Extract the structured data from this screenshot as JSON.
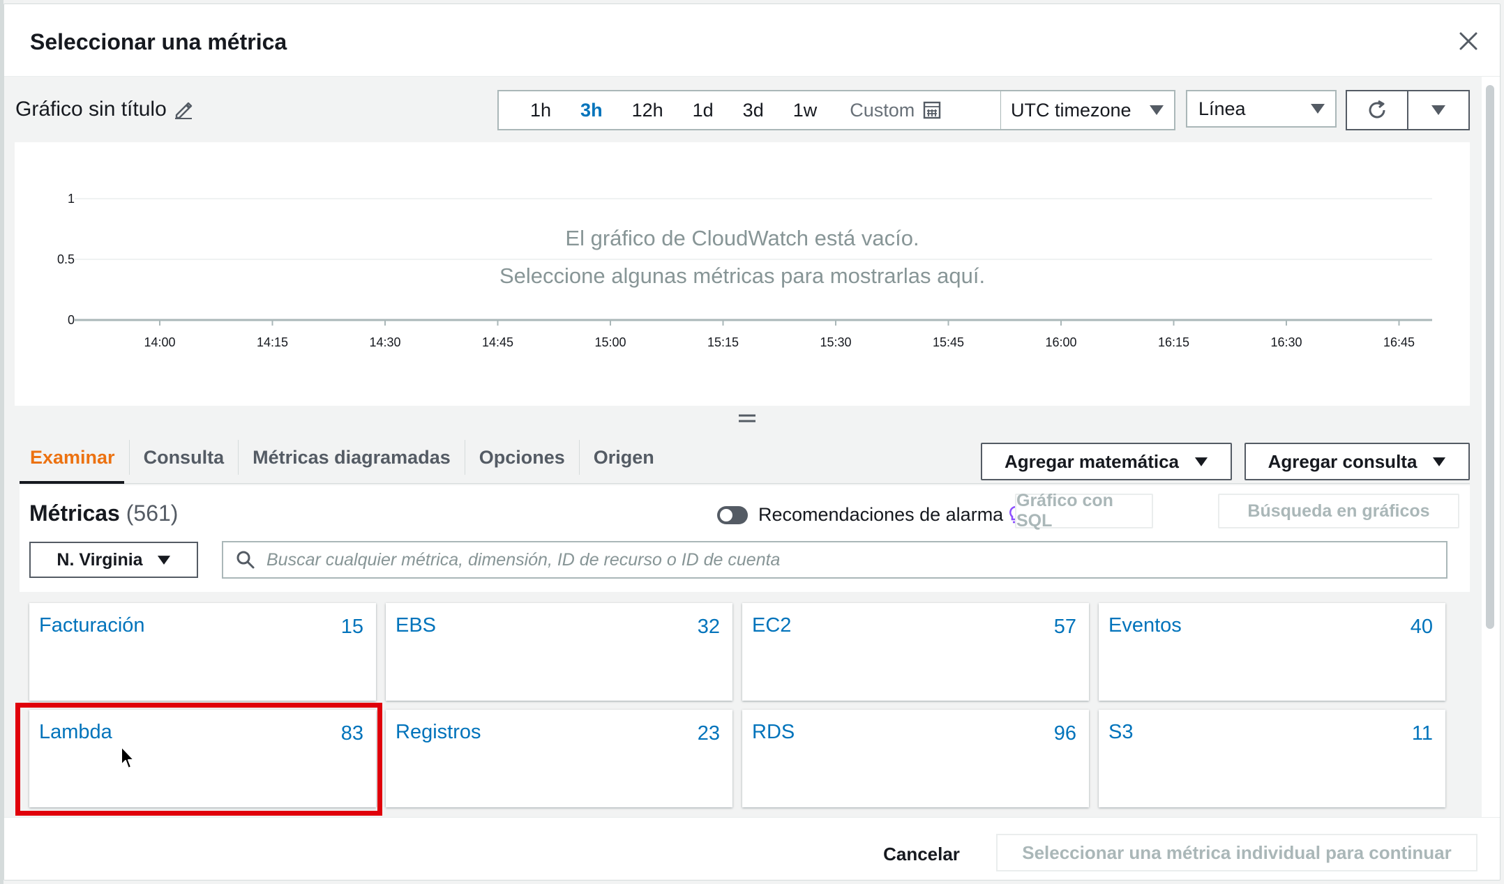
{
  "modal": {
    "title": "Seleccionar una métrica"
  },
  "graph": {
    "title": "Gráfico sin título",
    "time_ranges": [
      "1h",
      "3h",
      "12h",
      "1d",
      "3d",
      "1w"
    ],
    "active_time_range": "3h",
    "custom_label": "Custom",
    "timezone": "UTC timezone",
    "chart_type": "Línea",
    "empty_line1": "El gráfico de CloudWatch está vacío.",
    "empty_line2": "Seleccione algunas métricas para mostrarlas aquí."
  },
  "chart_data": {
    "type": "line",
    "title": "",
    "xlabel": "",
    "ylabel": "",
    "y_ticks": [
      "1",
      "0.5",
      "0"
    ],
    "ylim": [
      0,
      1
    ],
    "x": [
      "14:00",
      "14:15",
      "14:30",
      "14:45",
      "15:00",
      "15:15",
      "15:30",
      "15:45",
      "16:00",
      "16:15",
      "16:30",
      "16:45"
    ],
    "series": [],
    "grid": true
  },
  "tabs": [
    {
      "label": "Examinar",
      "active": true
    },
    {
      "label": "Consulta"
    },
    {
      "label": "Métricas diagramadas"
    },
    {
      "label": "Opciones"
    },
    {
      "label": "Origen"
    }
  ],
  "actions": {
    "add_math": "Agregar matemática",
    "add_query": "Agregar consulta"
  },
  "metrics": {
    "title": "Métricas",
    "count": "(561)",
    "alarm_recommendations": "Recomendaciones de alarma",
    "graph_sql": "Gráfico con SQL",
    "graph_search": "Búsqueda en gráficos",
    "region": "N. Virginia",
    "search_placeholder": "Buscar cualquier métrica, dimensión, ID de recurso o ID de cuenta",
    "namespaces": [
      {
        "name": "Facturación",
        "count": "15"
      },
      {
        "name": "EBS",
        "count": "32"
      },
      {
        "name": "EC2",
        "count": "57"
      },
      {
        "name": "Eventos",
        "count": "40"
      },
      {
        "name": "Lambda",
        "count": "83"
      },
      {
        "name": "Registros",
        "count": "23"
      },
      {
        "name": "RDS",
        "count": "96"
      },
      {
        "name": "S3",
        "count": "11"
      }
    ]
  },
  "footer": {
    "cancel": "Cancelar",
    "continue": "Seleccionar una métrica individual para continuar"
  },
  "colors": {
    "link": "#0073bb",
    "active_tab": "#ec7211",
    "highlight": "#e0000b",
    "lightbulb": "#8c4fff"
  }
}
